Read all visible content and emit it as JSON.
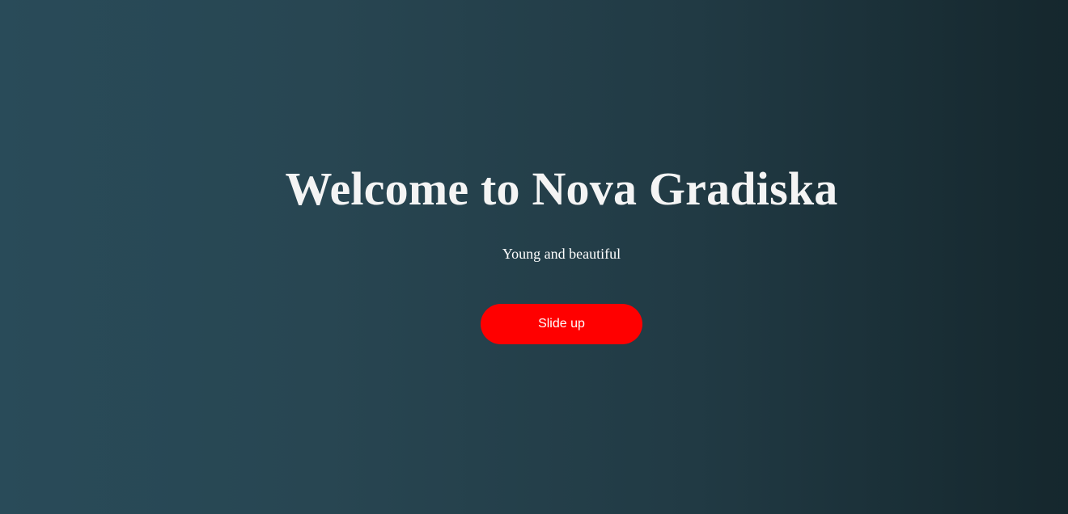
{
  "hero": {
    "title": "Welcome to Nova Gradiska",
    "subtitle": "Young and beautiful",
    "button_label": "Slide up"
  },
  "colors": {
    "background_left": "#294b59",
    "background_right": "#15272d",
    "button": "#ff0000",
    "text": "#ffffff"
  }
}
